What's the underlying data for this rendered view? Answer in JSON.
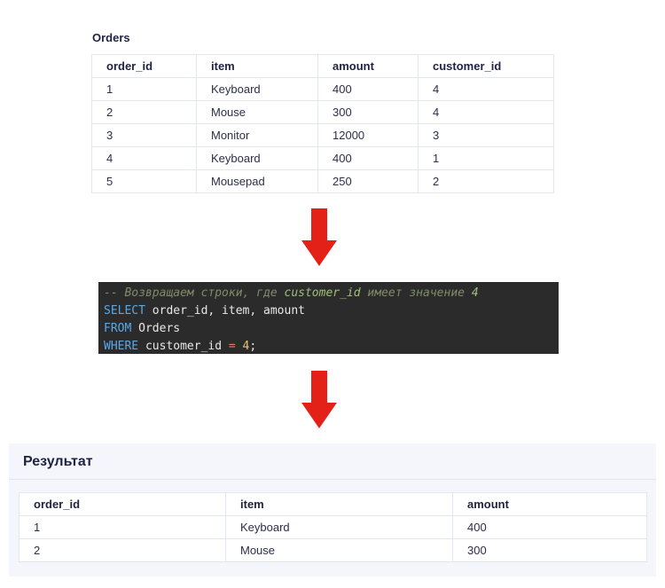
{
  "source": {
    "title": "Orders",
    "columns": [
      "order_id",
      "item",
      "amount",
      "customer_id"
    ],
    "rows": [
      [
        "1",
        "Keyboard",
        "400",
        "4"
      ],
      [
        "2",
        "Mouse",
        "300",
        "4"
      ],
      [
        "3",
        "Monitor",
        "12000",
        "3"
      ],
      [
        "4",
        "Keyboard",
        "400",
        "1"
      ],
      [
        "5",
        "Mousepad",
        "250",
        "2"
      ]
    ]
  },
  "code": {
    "comment_prefix": "-- Возвращаем строки, где ",
    "comment_field": "customer_id",
    "comment_mid": " имеет значение ",
    "comment_value": "4",
    "line2_kw": "SELECT",
    "line2_rest": " order_id, item, amount",
    "line3_kw": "FROM",
    "line3_rest": " Orders",
    "line4_kw": "WHERE",
    "line4_rest": " customer_id ",
    "line4_op": "=",
    "line4_num": " 4",
    "line4_end": ";"
  },
  "result": {
    "title": "Результат",
    "columns": [
      "order_id",
      "item",
      "amount"
    ],
    "rows": [
      [
        "1",
        "Keyboard",
        "400"
      ],
      [
        "2",
        "Mouse",
        "300"
      ]
    ]
  },
  "colors": {
    "arrow": "#e32119",
    "code_bg": "#2b2b2b",
    "keyword": "#5aa9e6"
  },
  "icons": [
    "down-arrow-icon",
    "down-arrow-icon"
  ]
}
